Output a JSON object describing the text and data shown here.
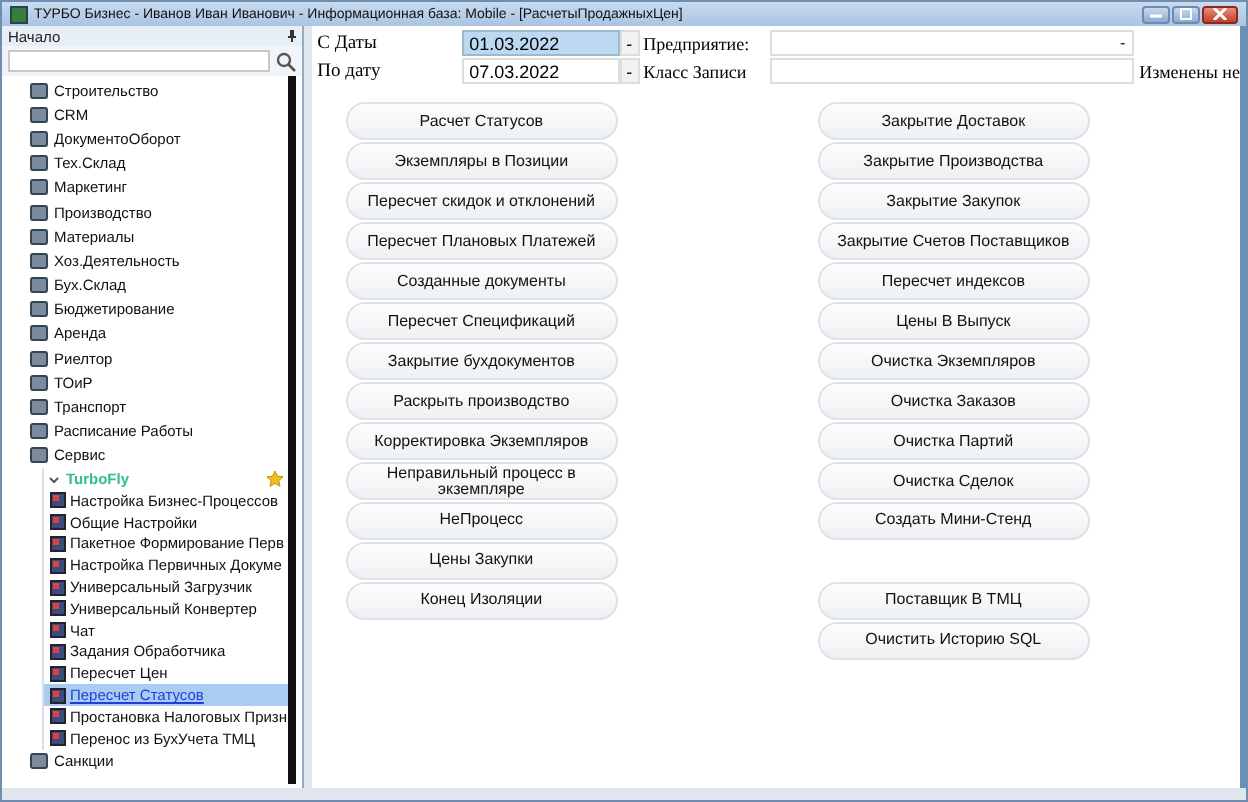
{
  "window": {
    "title": "ТУРБО Бизнес - Иванов Иван Иванович - Информационная база: Mobile - [РасчетыПродажныхЦен]"
  },
  "sidebar": {
    "title": "Начало",
    "items": [
      {
        "label": "Строительство"
      },
      {
        "label": "CRM"
      },
      {
        "label": "ДокументоОборот"
      },
      {
        "label": "Тех.Склад"
      },
      {
        "label": "Маркетинг"
      },
      {
        "label": "Производство"
      },
      {
        "label": "Материалы"
      },
      {
        "label": "Хоз.Деятельность"
      },
      {
        "label": "Бух.Склад"
      },
      {
        "label": "Бюджетирование"
      },
      {
        "label": "Аренда"
      },
      {
        "label": "Риелтор"
      },
      {
        "label": "ТОиР"
      },
      {
        "label": "Транспорт"
      },
      {
        "label": "Расписание Работы"
      },
      {
        "label": "Сервис",
        "expanded": true,
        "children": [
          {
            "label": "TurboFly",
            "expanded": true,
            "children": [
              {
                "label": "Настройка Бизнес-Процессов",
                "selected": false
              },
              {
                "label": "Общие Настройки",
                "selected": false
              },
              {
                "label": "Пакетное Формирование Перв",
                "selected": false
              },
              {
                "label": "Настройка Первичных Докуме",
                "selected": false
              },
              {
                "label": "Универсальный Загрузчик",
                "selected": false
              },
              {
                "label": "Универсальный Конвертер",
                "selected": false
              },
              {
                "label": "Чат",
                "selected": false
              },
              {
                "label": "Задания Обработчика",
                "selected": false
              },
              {
                "label": "Пересчет Цен",
                "selected": false
              },
              {
                "label": "Пересчет Статусов",
                "selected": true
              },
              {
                "label": "Простановка Налоговых Призн",
                "selected": false
              },
              {
                "label": "Перенос из БухУчета ТМЦ",
                "selected": false
              }
            ]
          }
        ]
      },
      {
        "label": "Санкции"
      }
    ]
  },
  "form": {
    "date_from": {
      "label": "С Даты",
      "value": "01.03.2022",
      "focused": true,
      "clear": "-"
    },
    "date_to": {
      "label": "По дату",
      "value": "07.03.2022",
      "focused": false,
      "clear": "-"
    },
    "enterprise": {
      "label": "Предприятие:",
      "clear": "-"
    },
    "record_class": {
      "label": "Класс Записи"
    },
    "changed_label": "Изменены не"
  },
  "left_buttons": [
    "Расчет Статусов",
    "Экземпляры в Позиции",
    "Пересчет скидок и отклонений",
    "Пересчет Плановых Платежей",
    "Созданные документы",
    "Пересчет Спецификаций",
    "Закрытие бухдокументов",
    "Раскрыть производство",
    "Корректировка Экземпляров",
    "Неправильный процесс в экземпляре",
    "НеПроцесс",
    "Цены Закупки",
    "Конец Изоляции"
  ],
  "right_buttons": [
    "Закрытие Доставок",
    "Закрытие Производства",
    "Закрытие Закупок",
    "Закрытие Счетов Поставщиков",
    "Пересчет индексов",
    "Цены В Выпуск",
    "Очистка Экземпляров",
    "Очистка Заказов",
    "Очистка Партий",
    "Очистка Сделок",
    "Создать Мини-Стенд"
  ],
  "right_buttons_2": [
    "Поставщик В ТМЦ",
    "Очистить Историю SQL"
  ]
}
